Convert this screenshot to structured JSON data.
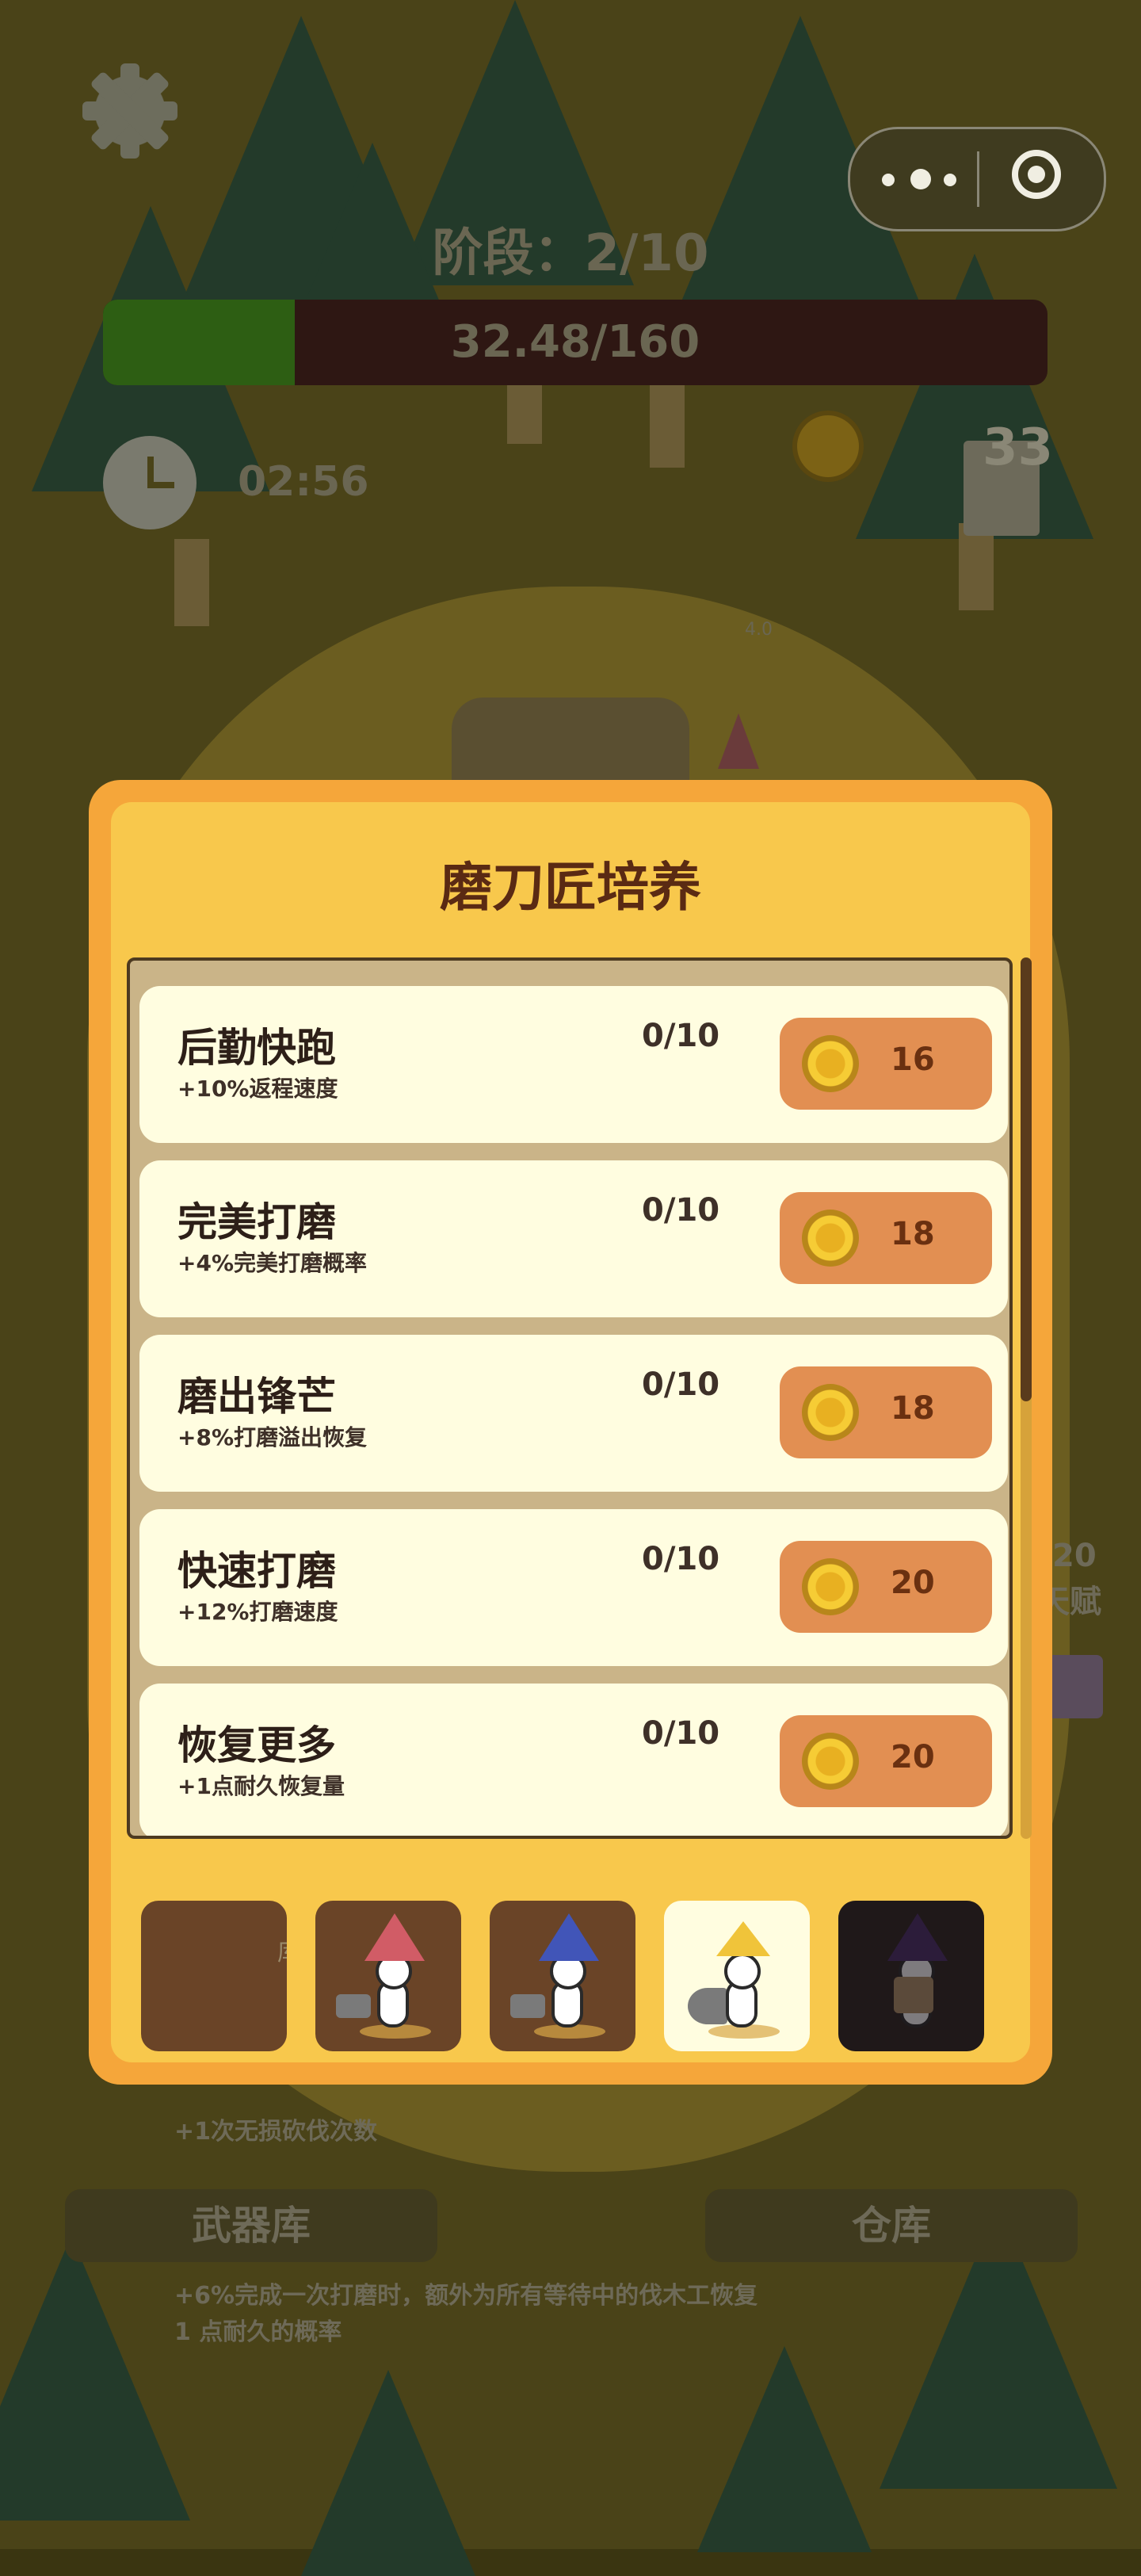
{
  "hud": {
    "stage_label": "阶段：2/10",
    "progress_text": "32.48/160",
    "progress_fraction": 0.203,
    "timer": "02:56",
    "resource_count": "33",
    "tiny_label": "4.0"
  },
  "background": {
    "side_number": "20",
    "side_talent": "天赋",
    "bottom_label": "+1次无损砍伐次数",
    "weapon_button": "武器库",
    "warehouse_button": "仓库",
    "bottom_desc": "+6%完成一次打磨时，额外为所有等待中的伐木工恢复 1 点耐久的概率"
  },
  "modal": {
    "title": "磨刀匠培养",
    "upgrades": [
      {
        "name": "后勤快跑",
        "desc": "+10%返程速度",
        "level": "0/10",
        "cost": "16"
      },
      {
        "name": "完美打磨",
        "desc": "+4%完美打磨概率",
        "level": "0/10",
        "cost": "18"
      },
      {
        "name": "磨出锋芒",
        "desc": "+8%打磨溢出恢复",
        "level": "0/10",
        "cost": "18"
      },
      {
        "name": "快速打磨",
        "desc": "+12%打磨速度",
        "level": "0/10",
        "cost": "20"
      },
      {
        "name": "恢复更多",
        "desc": "+1点耐久恢复量",
        "level": "0/10",
        "cost": "20"
      }
    ],
    "characters": {
      "ghost_label": "库阝"
    }
  },
  "colors": {
    "modal_outer": "#f5a63a",
    "modal_inner": "#f8c84c",
    "row_bg": "#fffde0",
    "cost_button": "#e28f52",
    "progress_fill": "#2d5e13",
    "progress_track": "#2e1713"
  }
}
